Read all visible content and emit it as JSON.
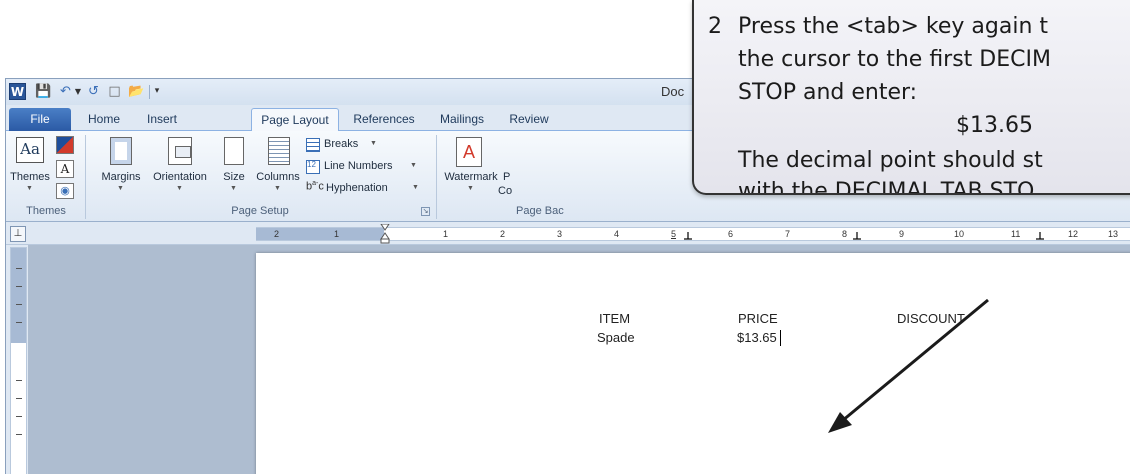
{
  "title_bar": {
    "word_icon": "W",
    "doc_title": "Doc",
    "icons": [
      "word-icon",
      "save-icon",
      "undo-icon",
      "redo-icon",
      "new-document-icon",
      "open-folder-icon",
      "customize-quick-access-icon"
    ]
  },
  "tabs": [
    "File",
    "Home",
    "Insert",
    "Page Layout",
    "References",
    "Mailings",
    "Review"
  ],
  "active_tab": "Page Layout",
  "ribbon": {
    "themes": {
      "label": "Themes",
      "group": "Themes"
    },
    "page_setup": {
      "margins": "Margins",
      "orientation": "Orientation",
      "size": "Size",
      "columns": "Columns",
      "breaks": "Breaks",
      "line_numbers": "Line Numbers",
      "hyphenation": "Hyphenation",
      "group": "Page Setup"
    },
    "page_background": {
      "watermark": "Watermark",
      "partial_1": "P",
      "partial_2": "Co",
      "group": "Page Bac"
    }
  },
  "ruler": {
    "left_numbers": [
      "2",
      "1"
    ],
    "right_numbers": [
      "1",
      "2",
      "3",
      "4",
      "5",
      "6",
      "7",
      "8",
      "9",
      "10",
      "11",
      "12",
      "13",
      "1"
    ]
  },
  "document": {
    "headers": [
      "ITEM",
      "PRICE",
      "DISCOUNT"
    ],
    "row": [
      "Spade",
      "$13.65"
    ]
  },
  "callout": {
    "step": "2",
    "line1": "Press the <tab> key again t",
    "line2": "the cursor to the first DECIM",
    "line3": "STOP and enter:",
    "value": "$13.65",
    "line4": "The decimal point should st",
    "line5": "with the DECIMAL TAB STO"
  },
  "colors": {
    "file_tab": "#2b5aa5",
    "ribbon_bg": "#dde7f3",
    "callout_border": "#333333"
  }
}
